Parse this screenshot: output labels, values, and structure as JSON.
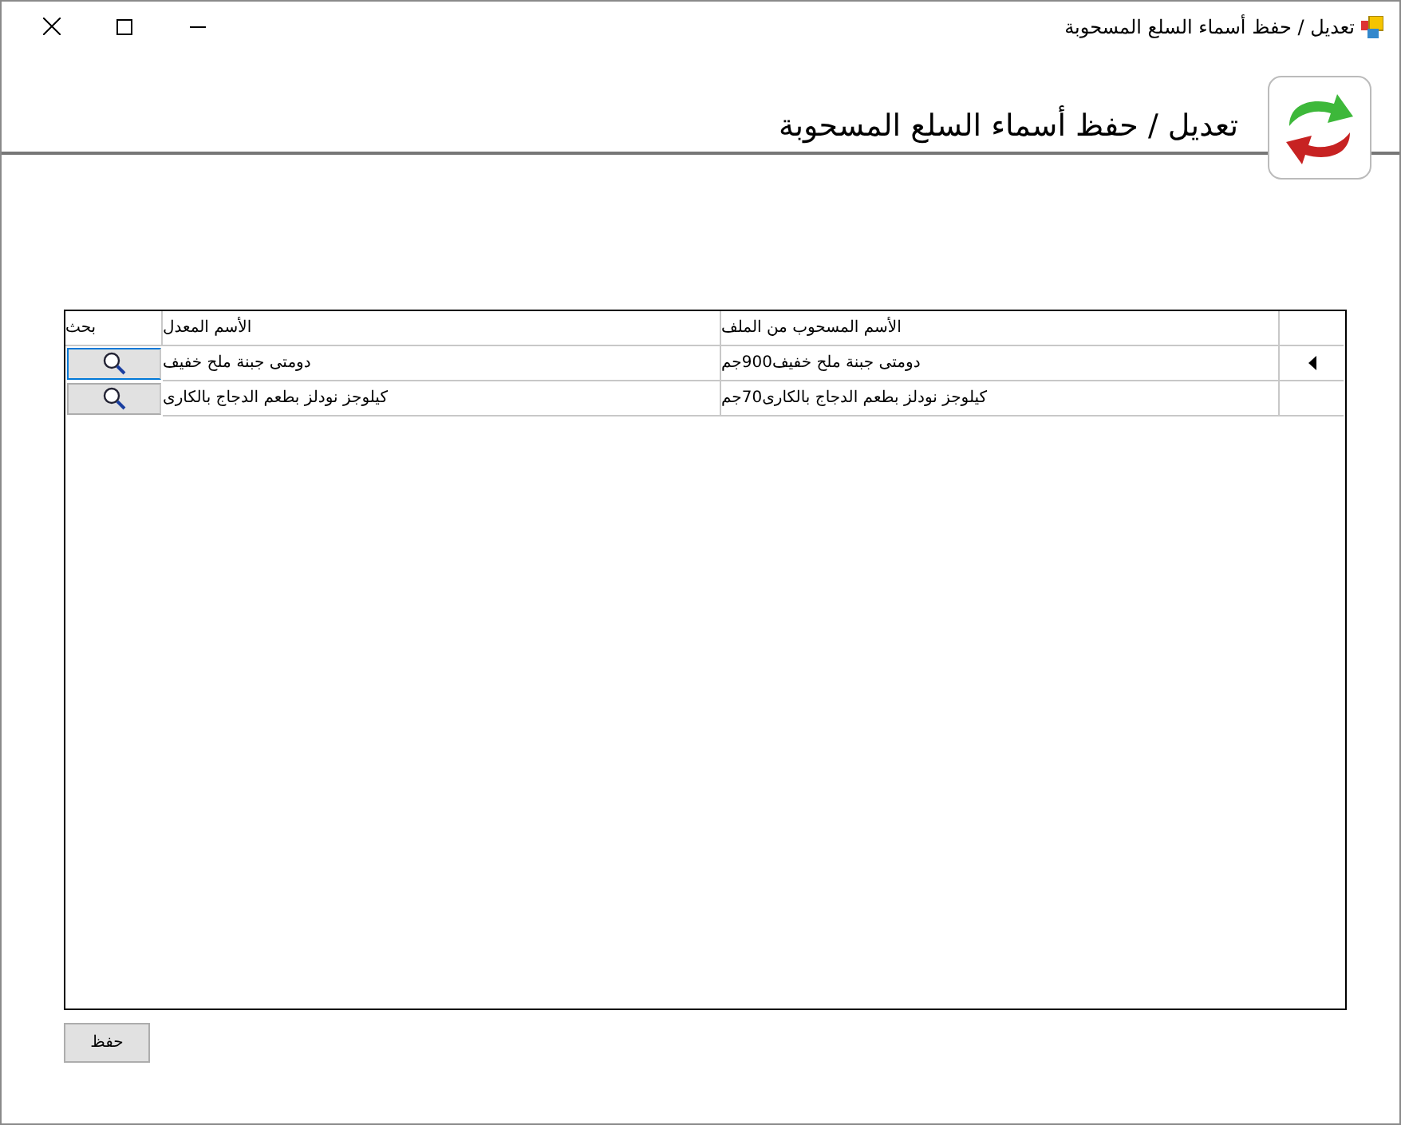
{
  "window": {
    "title": "تعديل / حفظ أسماء السلع المسحوبة"
  },
  "header": {
    "title": "تعديل / حفظ أسماء السلع المسحوبة"
  },
  "grid": {
    "columns": [
      "الأسم المسحوب من الملف",
      "الأسم المعدل",
      "بحث"
    ],
    "rows": [
      {
        "original": "دومتى جبنة ملح خفيف900جم",
        "edited": "دومتى جبنة ملح خفيف",
        "current": true
      },
      {
        "original": "كيلوجز نودلز بطعم الدجاج بالكارى70جم",
        "edited": "كيلوجز نودلز بطعم الدجاج بالكارى",
        "current": false
      }
    ]
  },
  "save_button": "حفظ"
}
